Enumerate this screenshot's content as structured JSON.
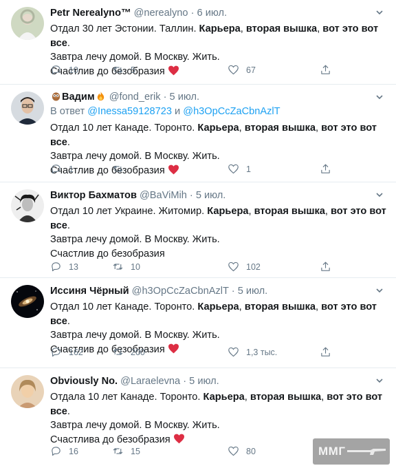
{
  "tweets": [
    {
      "name": "Petr Nerealyno™",
      "handle": "@nerealyno",
      "dot": "·",
      "time": "6 июл.",
      "lines": [
        "Отдал 30 лет Эстонии. Таллин. ",
        "Карьера",
        ", ",
        "вторая вышка",
        ", ",
        "вот это вот все",
        "."
      ],
      "line2": "Завтра лечу домой. В Москву. Жить.",
      "line3": "Счастлив до безобразия",
      "replies": "10",
      "retweets": "5",
      "likes": "67"
    },
    {
      "name": "Вадим",
      "handle": "@fond_erik",
      "dot": "·",
      "time": "5 июл.",
      "reply_prefix": "В ответ ",
      "reply_m1": "@Inessa59128723",
      "reply_and": " и ",
      "reply_m2": "@h3OpCcZaCbnAzlT",
      "lines": [
        "Отдал 10 лет Канаде. Торонто. ",
        "Карьера",
        ", ",
        "вторая вышка",
        ", ",
        "вот это вот все",
        "."
      ],
      "line2": "Завтра лечу домой. В Москву. Жить.",
      "line3": "Счастлив до безобразия",
      "replies": "1",
      "retweets": "",
      "likes": "1"
    },
    {
      "name": "Виктор Бахматов",
      "handle": "@BaViMih",
      "dot": "·",
      "time": "5 июл.",
      "lines": [
        "Отдал 10 лет Украине. Житомир. ",
        "Карьера",
        ", ",
        "вторая вышка",
        ", ",
        "вот это вот",
        ""
      ],
      "line_b": "все",
      "line2": "Завтра лечу домой. В Москву. Жить.",
      "line3": "Счастлив до безобразия",
      "replies": "13",
      "retweets": "10",
      "likes": "102"
    },
    {
      "name": "Иссиня Чёрный",
      "handle": "@h3OpCcZaCbnAzlT",
      "dot": "·",
      "time": "5 июл.",
      "lines": [
        "Отдал 10 лет Канаде. Торонто. ",
        "Карьера",
        ", ",
        "вторая вышка",
        ", ",
        "вот это вот все",
        "."
      ],
      "line2": "Завтра лечу домой. В Москву. Жить.",
      "line3": "Счастлив до безобразия",
      "replies": "162",
      "retweets": "200",
      "likes": "1,3 тыс."
    },
    {
      "name": "Obviously No.",
      "handle": "@Laraelevna",
      "dot": "·",
      "time": "5 июл.",
      "lines": [
        "Отдала 10 лет Канаде. Торонто. ",
        "Карьера",
        ", ",
        "вторая вышка",
        ", ",
        "вот это вот",
        ""
      ],
      "line_b": "все",
      "line2": "Завтра лечу домой. В Москву. Жить.",
      "line3": "Счастлива до безобразия",
      "replies": "16",
      "retweets": "15",
      "likes": "80"
    }
  ],
  "watermark": "ММГ",
  "colors": {
    "accent": "#1da1f2",
    "heart": "#e0245e",
    "muted": "#657786"
  }
}
